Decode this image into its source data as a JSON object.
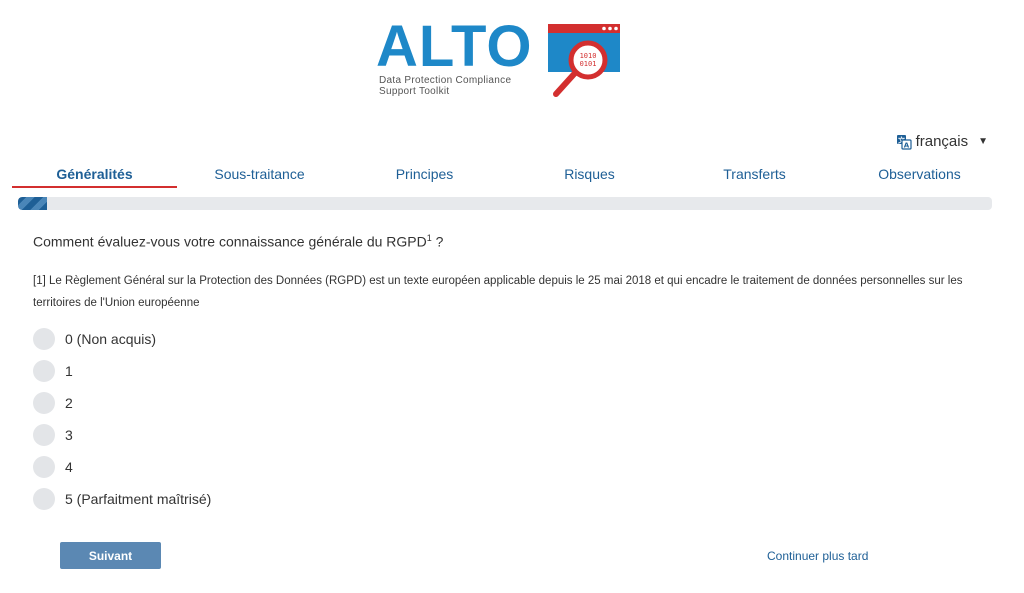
{
  "logo": {
    "wordmark_a": "A",
    "wordmark_lto": "LTO",
    "tagline_line1": "Data Protection Compliance",
    "tagline_line2": "Support Toolkit",
    "brand_blue": "#1e88c8",
    "brand_red": "#d32f2f"
  },
  "language": {
    "label": "français",
    "icon": "translate-icon"
  },
  "tabs": [
    {
      "label": "Généralités",
      "active": true
    },
    {
      "label": "Sous-traitance",
      "active": false
    },
    {
      "label": "Principes",
      "active": false
    },
    {
      "label": "Risques",
      "active": false
    },
    {
      "label": "Transferts",
      "active": false
    },
    {
      "label": "Observations",
      "active": false
    }
  ],
  "progress": {
    "fraction": 0.03
  },
  "question": {
    "text": "Comment évaluez-vous votre connaissance générale du RGPD",
    "sup": "1",
    "suffix": " ?",
    "footnote": "[1] Le Règlement Général sur la Protection des Données (RGPD) est un texte européen applicable depuis le 25 mai 2018 et qui encadre le traitement de données personnelles sur les territoires de l'Union européenne"
  },
  "options": [
    "0 (Non acquis)",
    "1",
    "2",
    "3",
    "4",
    "5 (Parfaitment maîtrisé)"
  ],
  "actions": {
    "next_label": "Suivant",
    "later_label": "Continuer plus tard"
  }
}
